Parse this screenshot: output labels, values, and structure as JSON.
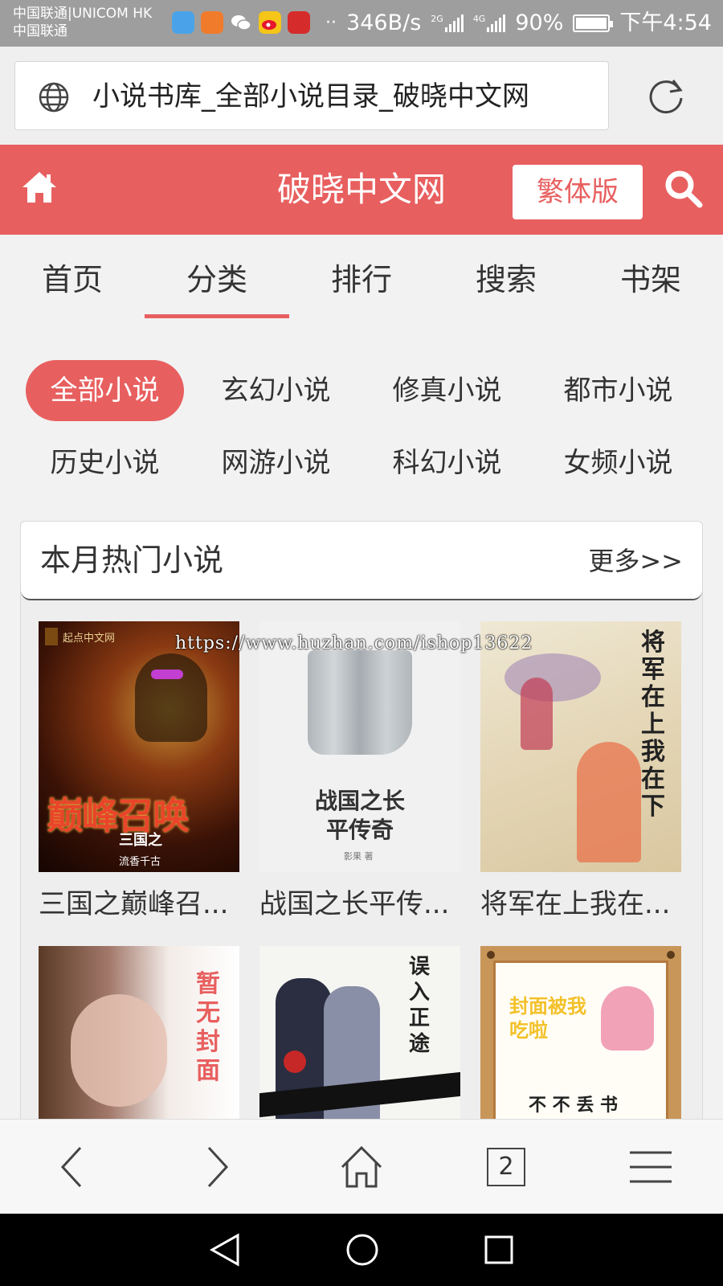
{
  "status_bar": {
    "carrier_1": "中国联通|UNICOM HK",
    "carrier_2": "中国联通",
    "speed": "346B/s",
    "net_1": "2G",
    "net_2": "4G",
    "battery": "90%",
    "battery_level": 0.9,
    "time": "下午4:54"
  },
  "browser": {
    "page_title": "小说书库_全部小说目录_破晓中文网",
    "tab_count": "2"
  },
  "site": {
    "name": "破晓中文网",
    "traditional_label": "繁体版",
    "brand_color": "#e85f5f"
  },
  "nav_tabs": [
    {
      "label": "首页",
      "active": false
    },
    {
      "label": "分类",
      "active": true
    },
    {
      "label": "排行",
      "active": false
    },
    {
      "label": "搜索",
      "active": false
    },
    {
      "label": "书架",
      "active": false
    }
  ],
  "categories": [
    {
      "label": "全部小说",
      "active": true
    },
    {
      "label": "玄幻小说",
      "active": false
    },
    {
      "label": "修真小说",
      "active": false
    },
    {
      "label": "都市小说",
      "active": false
    },
    {
      "label": "历史小说",
      "active": false
    },
    {
      "label": "网游小说",
      "active": false
    },
    {
      "label": "科幻小说",
      "active": false
    },
    {
      "label": "女频小说",
      "active": false
    }
  ],
  "hot_section": {
    "title": "本月热门小说",
    "more": "更多>>"
  },
  "books": [
    {
      "title": "三国之巅峰召...",
      "cover_title": "巅峰召唤",
      "cover_sub": "三国之",
      "cover_author": "流香千古",
      "publisher": "起点中文网"
    },
    {
      "title": "战国之长平传...",
      "cover_title": "战国之长平传奇",
      "cover_author": "影果 著"
    },
    {
      "title": "将军在上我在...",
      "cover_title": "将军在上我在下"
    },
    {
      "title": "",
      "cover_title": "暂无封面"
    },
    {
      "title": "",
      "cover_title": "误入正途"
    },
    {
      "title": "",
      "cover_title": "封面被我吃啦",
      "cover_sub": "不 不 丢 书"
    }
  ],
  "watermark": "https://www.huzhan.com/ishop13622"
}
